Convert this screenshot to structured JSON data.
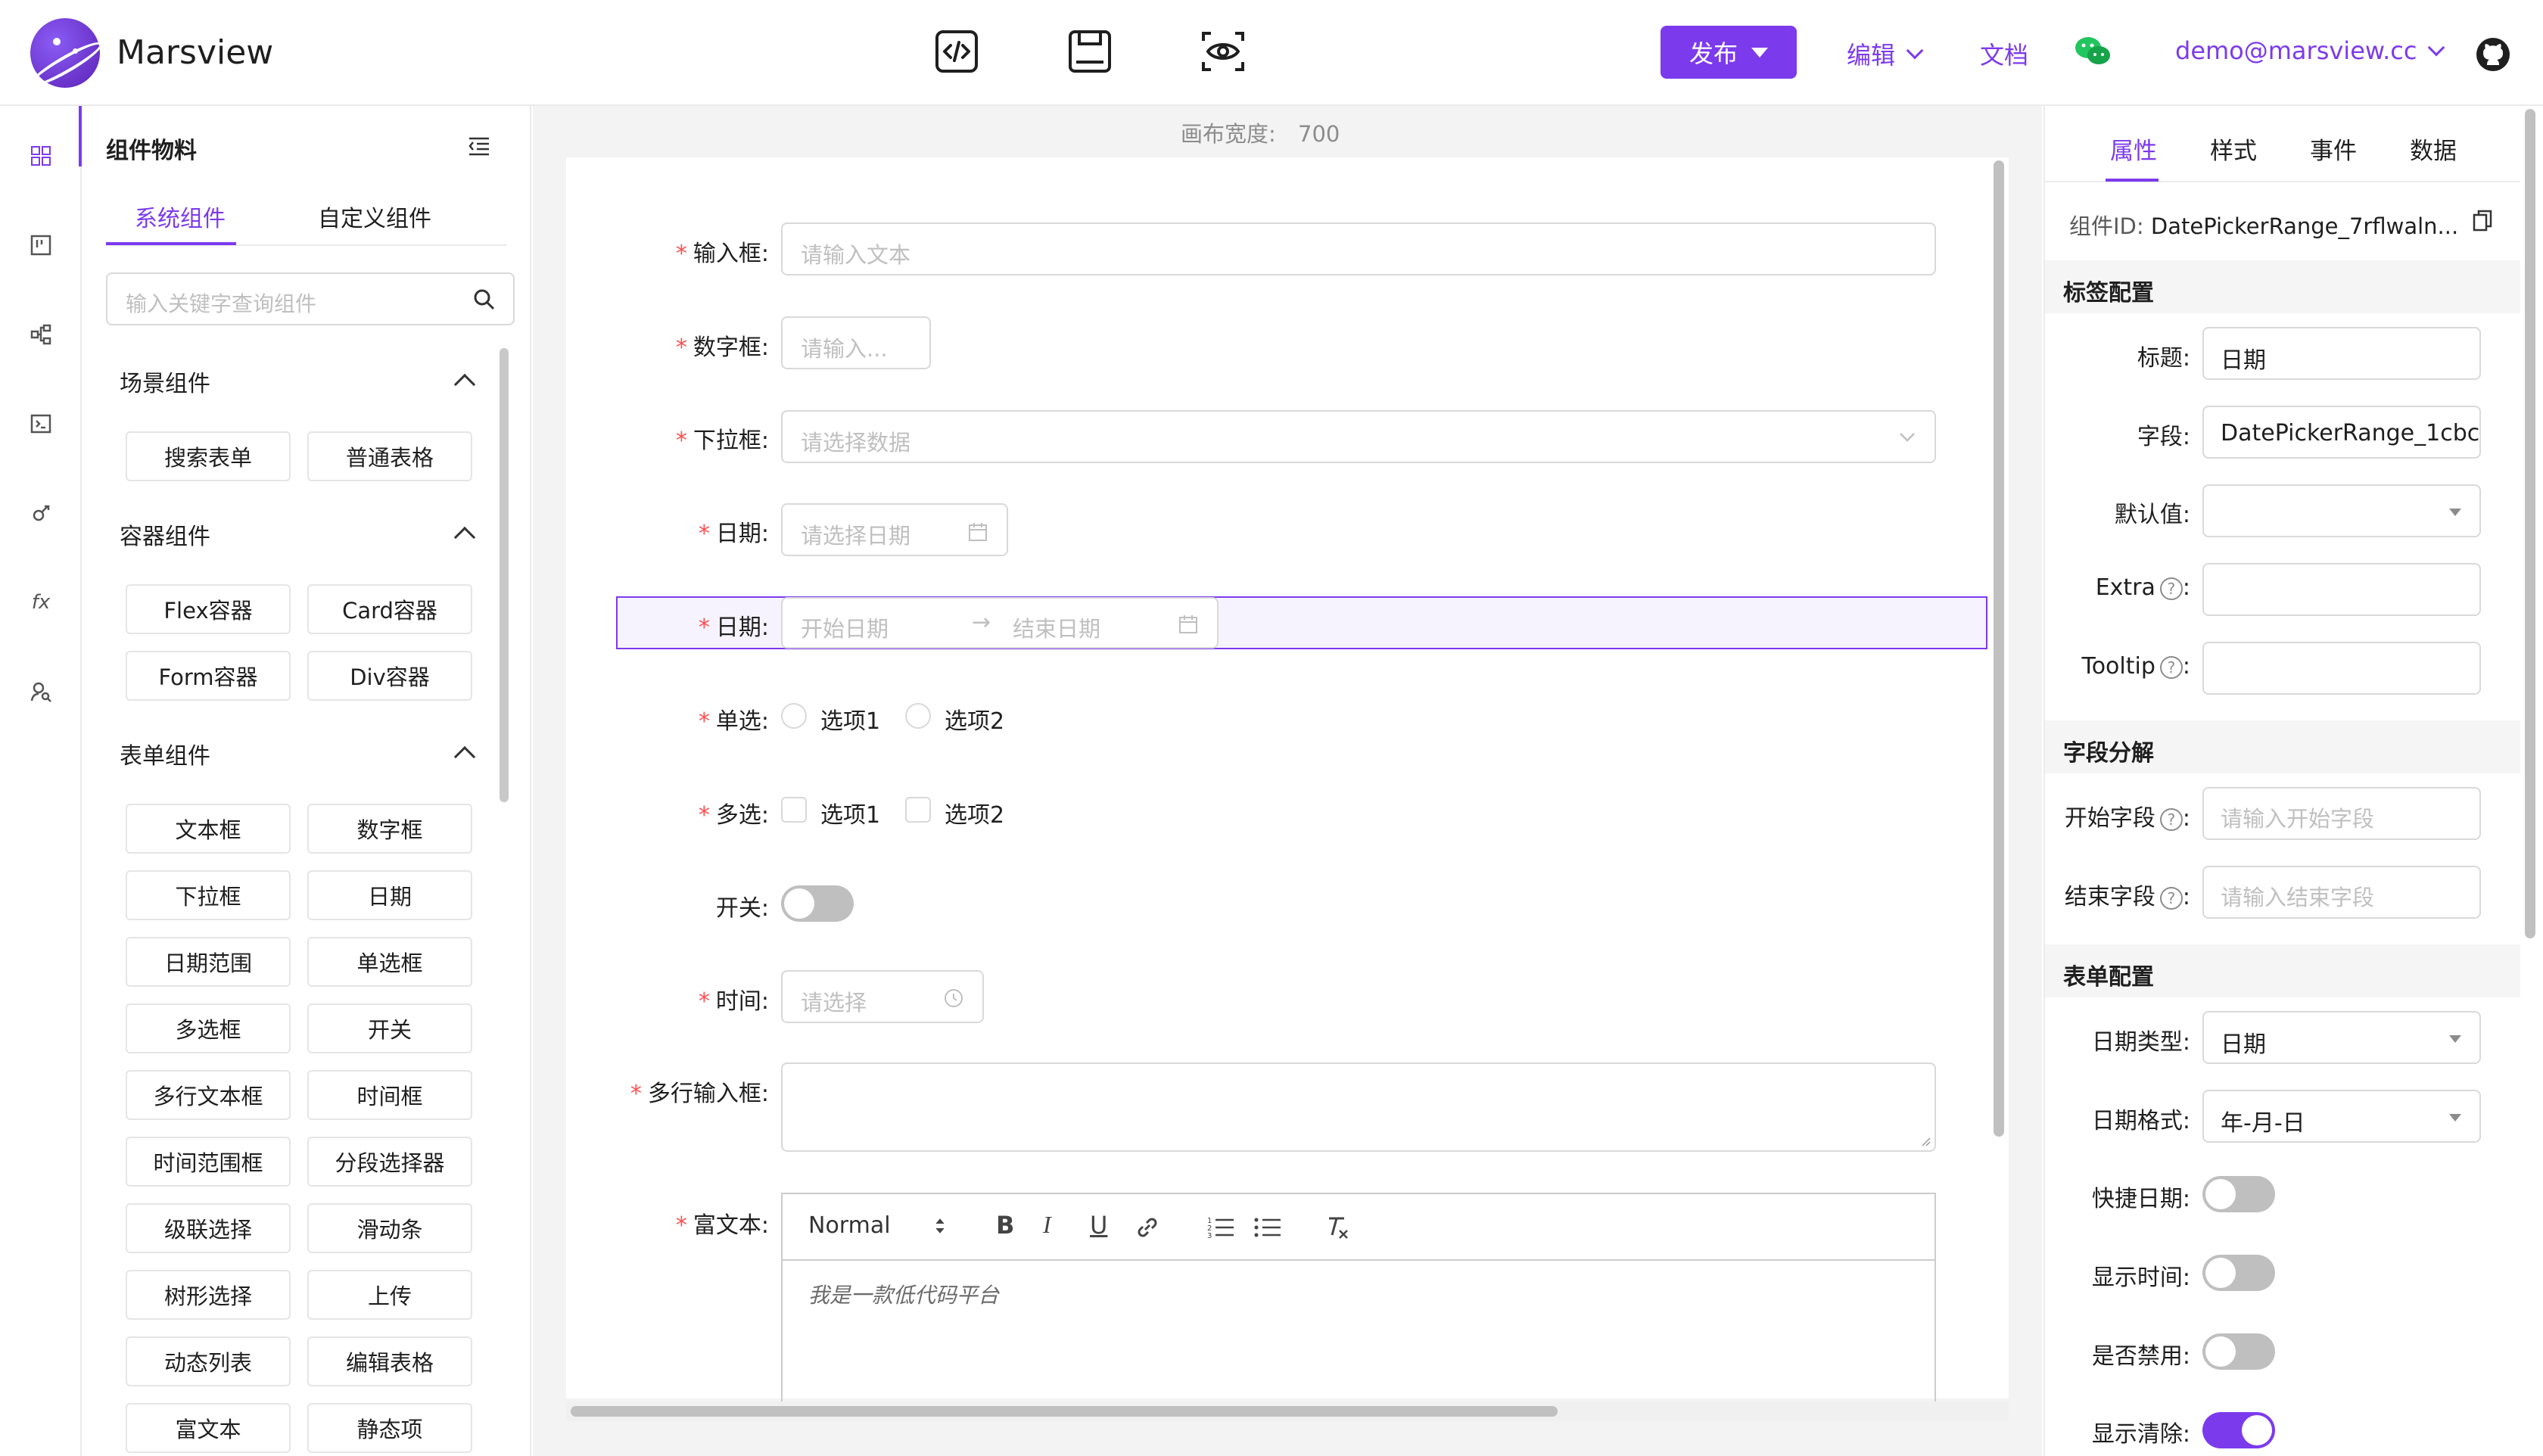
{
  "app": {
    "brand": "Marsview",
    "publish_label": "发布",
    "edit_label": "编辑",
    "docs_label": "文档",
    "user_email": "demo@marsview.cc",
    "accent_color": "#7c3aed"
  },
  "rail": {
    "icons": [
      "grid-icon",
      "kanban-icon",
      "tree-icon",
      "terminal-icon",
      "plugin-icon",
      "fx-icon",
      "user-search-icon"
    ],
    "fx_label": "fx"
  },
  "materials": {
    "title": "组件物料",
    "tabs": [
      "系统组件",
      "自定义组件"
    ],
    "search_placeholder": "输入关键字查询组件",
    "sections": [
      {
        "title": "场景组件",
        "items": [
          "搜索表单",
          "普通表格"
        ]
      },
      {
        "title": "容器组件",
        "items": [
          "Flex容器",
          "Card容器",
          "Form容器",
          "Div容器"
        ]
      },
      {
        "title": "表单组件",
        "items": [
          "文本框",
          "数字框",
          "下拉框",
          "日期",
          "日期范围",
          "单选框",
          "多选框",
          "开关",
          "多行文本框",
          "时间框",
          "时间范围框",
          "分段选择器",
          "级联选择",
          "滑动条",
          "树形选择",
          "上传",
          "动态列表",
          "编辑表格",
          "富文本",
          "静态项"
        ]
      }
    ]
  },
  "canvas": {
    "width_label": "画布宽度:",
    "width_value": "700",
    "fields": [
      {
        "label": "输入框:",
        "required": "*",
        "placeholder": "请输入文本"
      },
      {
        "label": "数字框:",
        "required": "*",
        "placeholder": "请输入..."
      },
      {
        "label": "下拉框:",
        "required": "*",
        "placeholder": "请选择数据"
      },
      {
        "label": "日期:",
        "required": "*",
        "placeholder": "请选择日期"
      },
      {
        "label": "日期:",
        "required": "*",
        "start_placeholder": "开始日期",
        "end_placeholder": "结束日期"
      },
      {
        "label": "单选:",
        "required": "*",
        "options": [
          "选项1",
          "选项2"
        ]
      },
      {
        "label": "多选:",
        "required": "*",
        "options": [
          "选项1",
          "选项2"
        ]
      },
      {
        "label": "开关:"
      },
      {
        "label": "时间:",
        "required": "*",
        "placeholder": "请选择"
      },
      {
        "label": "多行输入框:",
        "required": "*"
      },
      {
        "label": "富文本:",
        "required": "*",
        "format": "Normal",
        "content": "我是一款低代码平台"
      }
    ],
    "rich_text_tools": [
      "bold-icon",
      "italic-icon",
      "underline-icon",
      "link-icon",
      "ordered-list-icon",
      "bullet-list-icon",
      "clear-format-icon"
    ]
  },
  "props": {
    "tabs": [
      "属性",
      "样式",
      "事件",
      "数据"
    ],
    "component_id_label": "组件ID:",
    "component_id": "DatePickerRange_7rflwaln...",
    "sections": {
      "label_config": "标签配置",
      "field_split": "字段分解",
      "form_config": "表单配置"
    },
    "title_label": "标题:",
    "title_value": "日期",
    "field_label": "字段:",
    "field_value": "DatePickerRange_1cbc",
    "default_label": "默认值:",
    "extra_label": "Extra",
    "tooltip_label": "Tooltip",
    "start_field_label": "开始字段",
    "start_field_placeholder": "请输入开始字段",
    "end_field_label": "结束字段",
    "end_field_placeholder": "请输入结束字段",
    "date_type_label": "日期类型:",
    "date_type_value": "日期",
    "date_format_label": "日期格式:",
    "date_format_value": "年-月-日",
    "quick_date_label": "快捷日期:",
    "quick_date_on": false,
    "show_time_label": "显示时间:",
    "show_time_on": false,
    "disabled_label": "是否禁用:",
    "disabled_on": false,
    "allow_clear_label": "显示清除:",
    "allow_clear_on": true,
    "colon": ":",
    "help_glyph": "?"
  }
}
